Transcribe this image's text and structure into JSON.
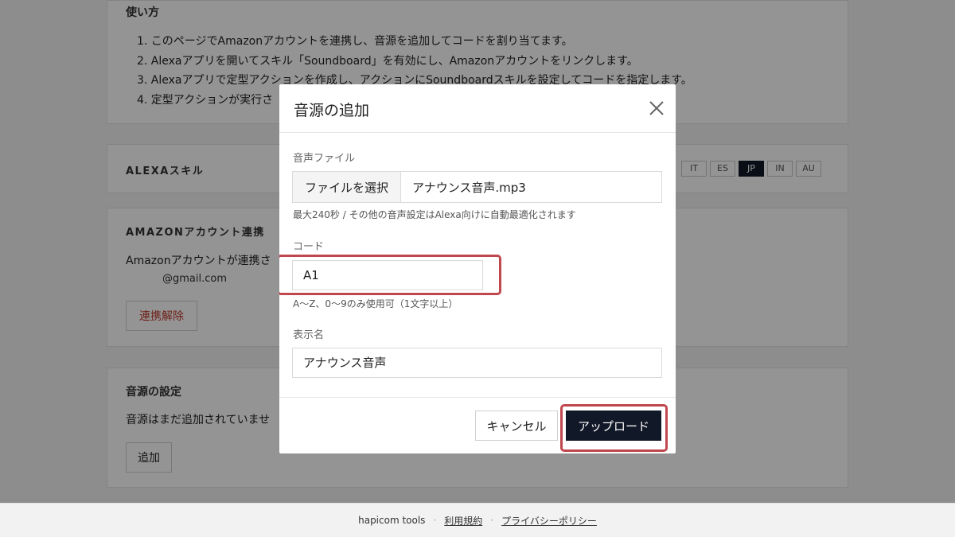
{
  "usage": {
    "title": "使い方",
    "steps": [
      "1. このページでAmazonアカウントを連携し、音源を追加してコードを割り当てます。",
      "2. Alexaアプリを開いてスキル「Soundboard」を有効にし、Amazonアカウントをリンクします。",
      "3. Alexaアプリで定型アクションを作成し、アクションにSoundboardスキルを設定してコードを指定します。",
      "4. 定型アクションが実行さ"
    ]
  },
  "alexa_skill": {
    "title": "ALEXAスキル",
    "tabs": [
      "IT",
      "ES",
      "JP",
      "IN",
      "AU"
    ],
    "active_tab": "JP"
  },
  "amazon": {
    "title": "AMAZONアカウント連携",
    "linked_text": "Amazonアカウントが連携さ",
    "email": "@gmail.com",
    "unlink_label": "連携解除"
  },
  "sound": {
    "title": "音源の設定",
    "empty_text": "音源はまだ追加されていませ",
    "add_label": "追加"
  },
  "footer": {
    "brand": "hapicom tools",
    "sep": "·",
    "terms": "利用規約",
    "privacy": "プライバシーポリシー"
  },
  "modal": {
    "title": "音源の追加",
    "close_icon": "close-icon",
    "audio_label": "音声ファイル",
    "file_button": "ファイルを選択",
    "file_name": "アナウンス音声.mp3",
    "audio_help": "最大240秒 / その他の音声設定はAlexa向けに自動最適化されます",
    "code_label": "コード",
    "code_value": "A1",
    "code_help": "A〜Z、0〜9のみ使用可（1文字以上）",
    "display_label": "表示名",
    "display_value": "アナウンス音声",
    "cancel_label": "キャンセル",
    "upload_label": "アップロード"
  },
  "colors": {
    "highlight": "#c0474e",
    "primary": "#111827",
    "danger": "#c0392b"
  }
}
